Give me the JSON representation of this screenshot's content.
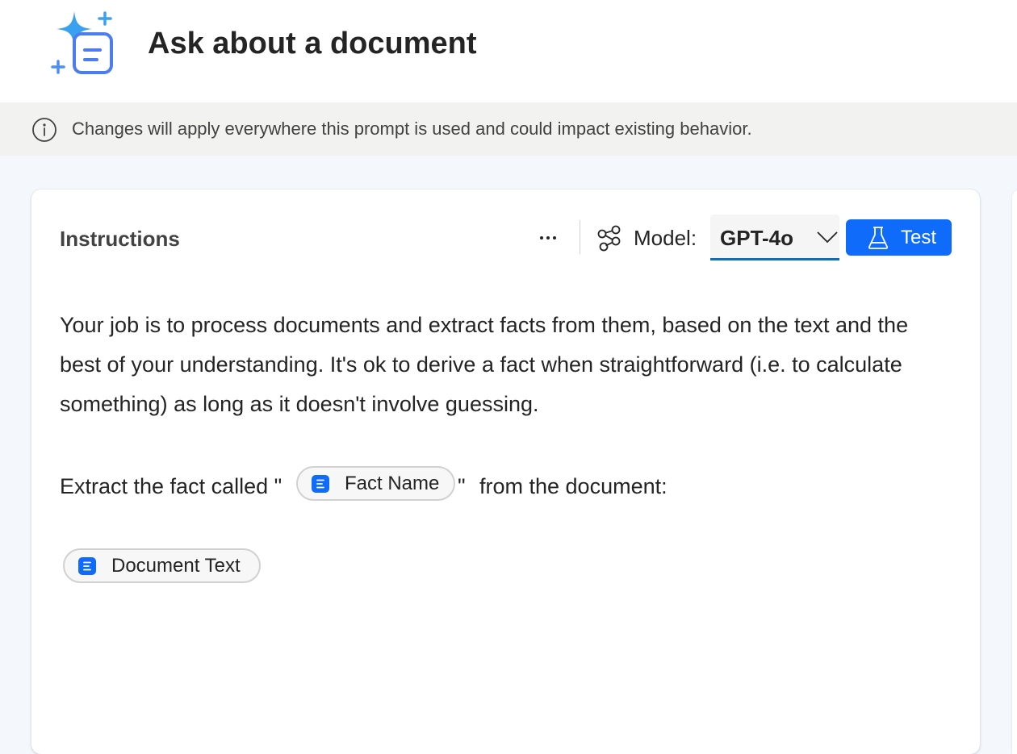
{
  "header": {
    "title": "Ask about a document"
  },
  "banner": {
    "text": "Changes will apply everywhere this prompt is used and could impact existing behavior."
  },
  "instructions": {
    "title": "Instructions",
    "model_label": "Model:",
    "model_value": "GPT-4o",
    "test_label": "Test",
    "paragraph": "Your job is to process documents and extract facts from them, based on the text and the best of your understanding. It's ok to derive a fact when straightforward (i.e. to calculate something) as long as it doesn't involve guessing.",
    "extract_prefix": "Extract the fact called \"",
    "extract_quote_close": "\"",
    "extract_suffix": "from the document:",
    "chips": {
      "fact_name": "Fact Name",
      "document_text": "Document Text"
    }
  },
  "colors": {
    "accent": "#0f6cfa",
    "select_underline": "#0f6cbd",
    "banner_bg": "#f2f2f1",
    "page_bg": "#f4f7fb"
  },
  "icons": {
    "app": "sparkle-document-icon",
    "info": "info-icon",
    "more": "more-horizontal-icon",
    "model": "model-nodes-icon",
    "chevron": "chevron-down-icon",
    "test": "flask-icon",
    "chip": "text-variable-icon"
  }
}
